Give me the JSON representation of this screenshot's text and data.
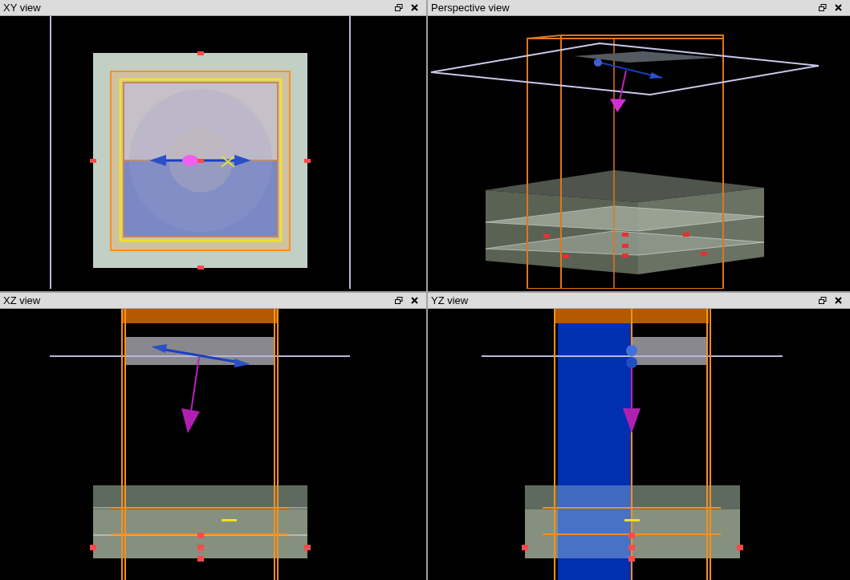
{
  "views": [
    {
      "title": "XY view",
      "kind": "xy"
    },
    {
      "title": "Perspective view",
      "kind": "perspective"
    },
    {
      "title": "XZ view",
      "kind": "xz"
    },
    {
      "title": "YZ view",
      "kind": "yz"
    }
  ]
}
